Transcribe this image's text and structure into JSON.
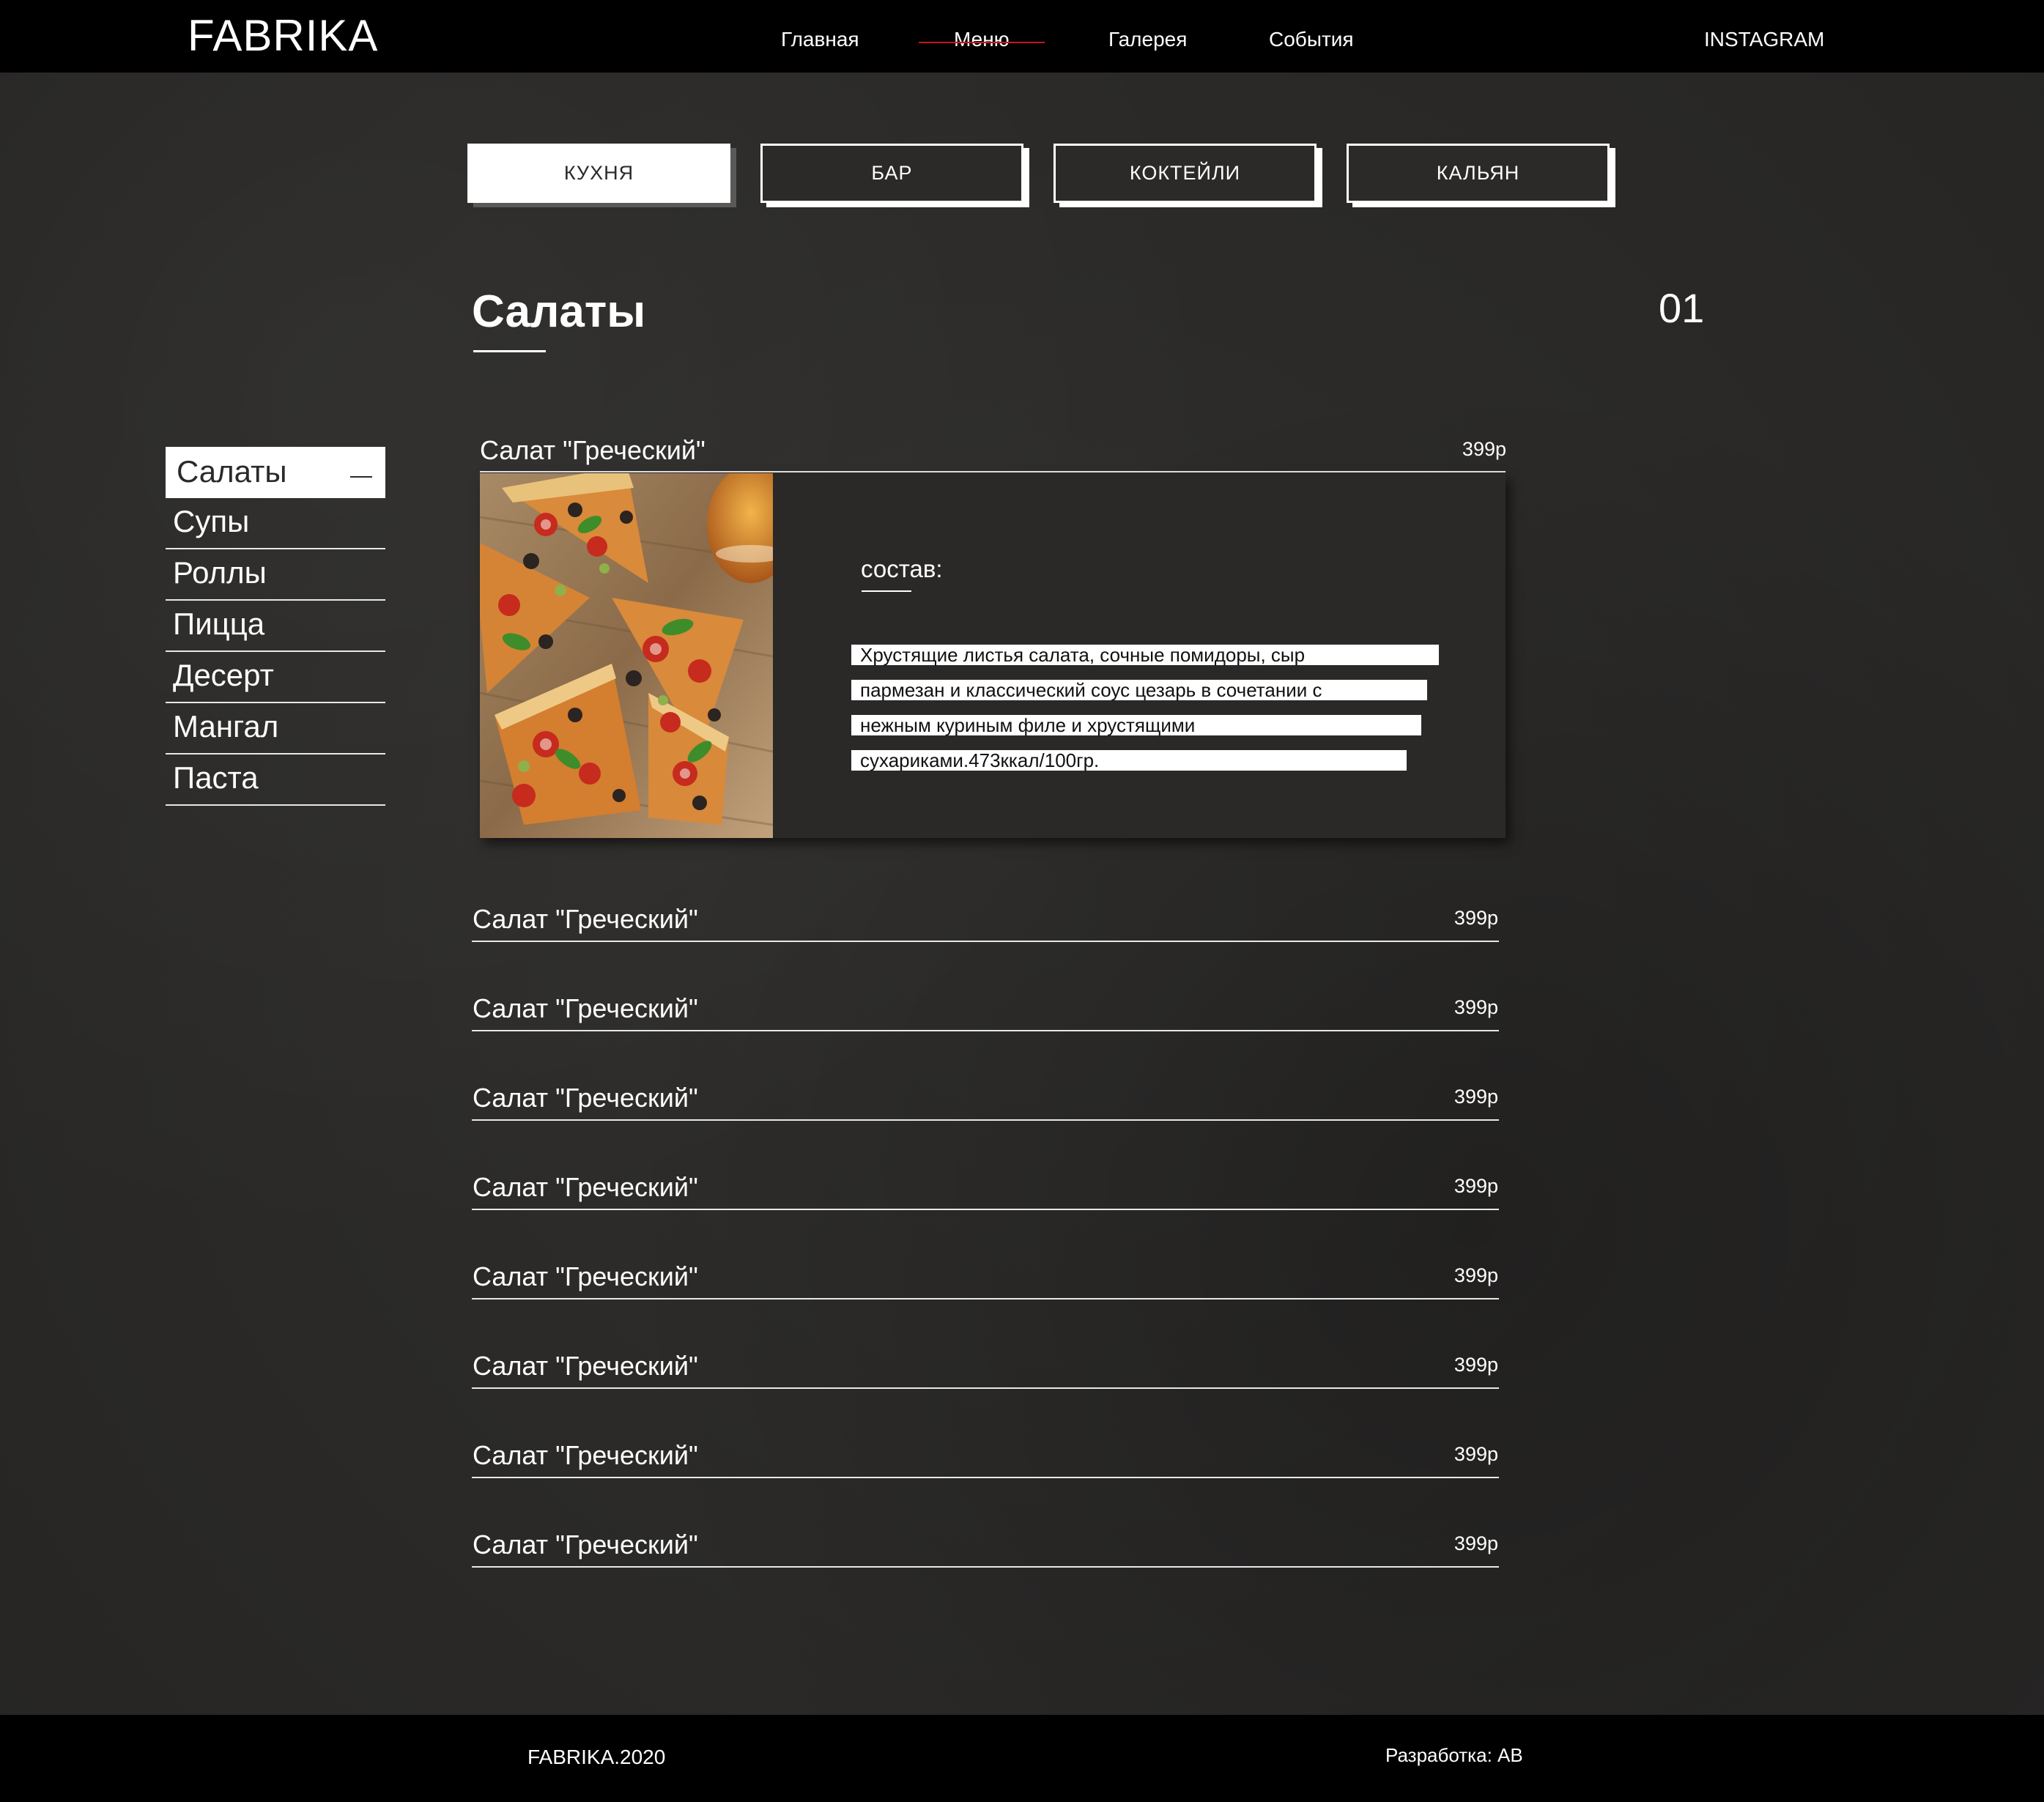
{
  "header": {
    "logo": "FABRIKA",
    "nav": [
      {
        "label": "Главная"
      },
      {
        "label": "Меню"
      },
      {
        "label": "Галерея"
      },
      {
        "label": "События"
      }
    ],
    "instagram": "INSTAGRAM"
  },
  "tabs": [
    {
      "label": "КУХНЯ",
      "active": true
    },
    {
      "label": "БАР"
    },
    {
      "label": "КОКТЕЙЛИ"
    },
    {
      "label": "КАЛЬЯН"
    }
  ],
  "section": {
    "title": "Салаты",
    "number": "01"
  },
  "sidebar": {
    "items": [
      {
        "label": "Салаты",
        "active": true
      },
      {
        "label": "Супы"
      },
      {
        "label": "Роллы"
      },
      {
        "label": "Пицца"
      },
      {
        "label": "Десерт"
      },
      {
        "label": "Мангал"
      },
      {
        "label": "Паста"
      }
    ]
  },
  "featured": {
    "name": "Салат \"Греческий\"",
    "price": "399р",
    "composition_label": "состав:",
    "description_lines": [
      "Хрустящие листья салата, сочные помидоры, сыр",
      "пармезан и классический соус цезарь в сочетании с",
      "нежным куриным филе и хрустящими",
      "сухариками.473ккал/100гр."
    ]
  },
  "menu_items": [
    {
      "name": "Салат \"Греческий\"",
      "price": "399р"
    },
    {
      "name": "Салат \"Греческий\"",
      "price": "399р"
    },
    {
      "name": "Салат \"Греческий\"",
      "price": "399р"
    },
    {
      "name": "Салат \"Греческий\"",
      "price": "399р"
    },
    {
      "name": "Салат \"Греческий\"",
      "price": "399р"
    },
    {
      "name": "Салат \"Греческий\"",
      "price": "399р"
    },
    {
      "name": "Салат \"Греческий\"",
      "price": "399р"
    },
    {
      "name": "Салат \"Греческий\"",
      "price": "399р"
    }
  ],
  "footer": {
    "copyright": "FABRIKA.2020",
    "developer": "Разработка: АВ"
  },
  "colors": {
    "background": "#2b2a29",
    "bar": "#000000",
    "accent": "#c8151b",
    "text": "#ffffff"
  }
}
